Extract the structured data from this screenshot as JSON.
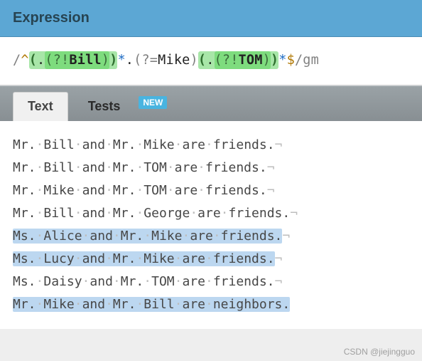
{
  "header": {
    "title": "Expression"
  },
  "regex": {
    "open_delim": "/",
    "anchor_start": "^",
    "g1_open": "(",
    "g1_dot": ".",
    "g1_la_open": "(?!",
    "g1_lit": "Bill",
    "g1_la_close": ")",
    "g1_close": ")",
    "q1": "*",
    "mid_dot": ".",
    "pla_open": "(?=",
    "pla_lit": "Mike",
    "pla_close": ")",
    "g2_open": "(",
    "g2_dot": ".",
    "g2_la_open": "(?!",
    "g2_lit": "TOM",
    "g2_la_close": ")",
    "g2_close": ")",
    "q2": "*",
    "anchor_end": "$",
    "close_delim": "/",
    "flags": "gm"
  },
  "tabs": {
    "text": "Text",
    "tests": "Tests",
    "badge": "NEW"
  },
  "lines": [
    {
      "words": [
        "Mr.",
        "Bill",
        "and",
        "Mr.",
        "Mike",
        "are",
        "friends."
      ],
      "match": false
    },
    {
      "words": [
        "Mr.",
        "Bill",
        "and",
        "Mr.",
        "TOM",
        "are",
        "friends."
      ],
      "match": false
    },
    {
      "words": [
        "Mr.",
        "Mike",
        "and",
        "Mr.",
        "TOM",
        "are",
        "friends."
      ],
      "match": false
    },
    {
      "words": [
        "Mr.",
        "Bill",
        "and",
        "Mr.",
        "George",
        "are",
        "friends."
      ],
      "match": false
    },
    {
      "words": [
        "Ms.",
        "Alice",
        "and",
        "Mr.",
        "Mike",
        "are",
        "friends."
      ],
      "match": true
    },
    {
      "words": [
        "Ms.",
        "Lucy",
        "and",
        "Mr.",
        "Mike",
        "are",
        "friends."
      ],
      "match": true
    },
    {
      "words": [
        "Ms.",
        "Daisy",
        "and",
        "Mr.",
        "TOM",
        "are",
        "friends."
      ],
      "match": false
    },
    {
      "words": [
        "Mr.",
        "Mike",
        "and",
        "Mr.",
        "Bill",
        "are",
        "neighbors."
      ],
      "match": true
    }
  ],
  "watermark": "CSDN @jiejingguo"
}
